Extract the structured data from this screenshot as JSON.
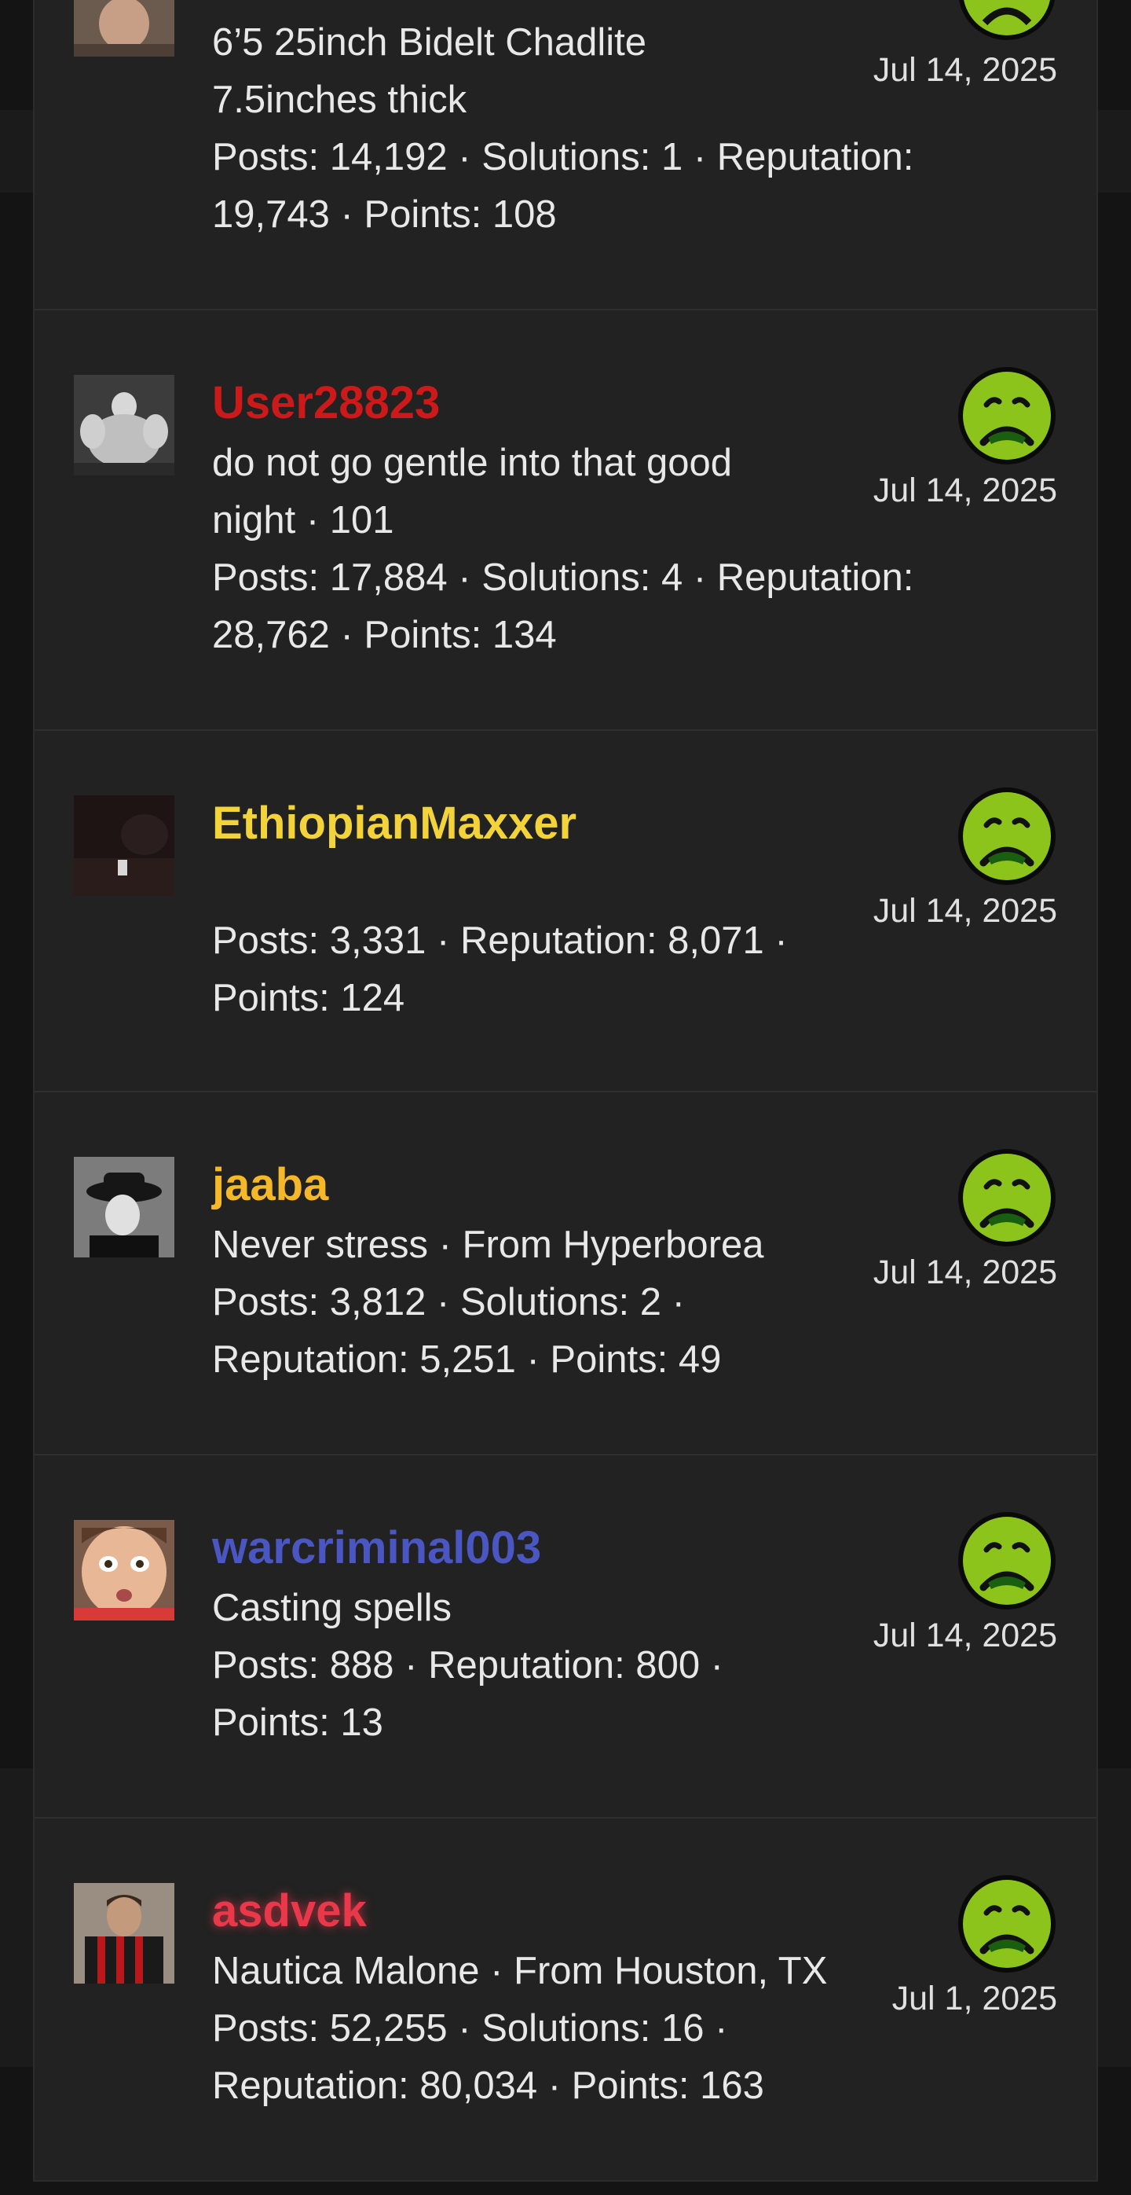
{
  "reactions": [
    {
      "username": "",
      "username_color": "#e8e8e8",
      "lines": [
        "6’5 25inch Bidelt Chadlite",
        "7.5inches thick"
      ],
      "stats_lines": [
        "Posts: 14,192 · Solutions: 1 · Reputation:",
        "19,743 · Points: 108"
      ],
      "date": "Jul 14, 2025",
      "reaction_icon": "sick-face-icon"
    },
    {
      "username": "User28823",
      "username_color": "#cc1a1a",
      "lines": [
        "do not go gentle into that good",
        "night · 101"
      ],
      "stats_lines": [
        "Posts: 17,884 · Solutions: 4 · Reputation:",
        "28,762 · Points: 134"
      ],
      "date": "Jul 14, 2025",
      "reaction_icon": "sick-face-icon"
    },
    {
      "username": "EthiopianMaxxer",
      "username_color": "#f2d33a",
      "lines": [],
      "stats_lines": [
        "Posts: 3,331 · Reputation: 8,071 ·",
        "Points: 124"
      ],
      "date": "Jul 14, 2025",
      "reaction_icon": "sick-face-icon"
    },
    {
      "username": "jaaba",
      "username_color": "#f5b82a",
      "lines": [
        "Never stress · From Hyperborea"
      ],
      "stats_lines": [
        "Posts: 3,812 · Solutions: 2 ·",
        "Reputation: 5,251 · Points: 49"
      ],
      "date": "Jul 14, 2025",
      "reaction_icon": "sick-face-icon"
    },
    {
      "username": "warcriminal003",
      "username_color": "#4a56c2",
      "lines": [
        "Casting spells"
      ],
      "stats_lines": [
        "Posts: 888 · Reputation: 800 ·",
        "Points: 13"
      ],
      "date": "Jul 14, 2025",
      "reaction_icon": "sick-face-icon"
    },
    {
      "username": "asdvek",
      "username_color": "#e8384a",
      "lines": [
        "Nautica Malone · From Houston, TX"
      ],
      "stats_lines": [
        "Posts: 52,255 · Solutions: 16 ·",
        "Reputation: 80,034 · Points: 163"
      ],
      "date": "Jul 1, 2025",
      "reaction_icon": "sick-face-icon"
    }
  ],
  "colors": {
    "panel_bg": "#222222",
    "text": "#e8e8e8",
    "reaction_green": "#8cc41c"
  }
}
